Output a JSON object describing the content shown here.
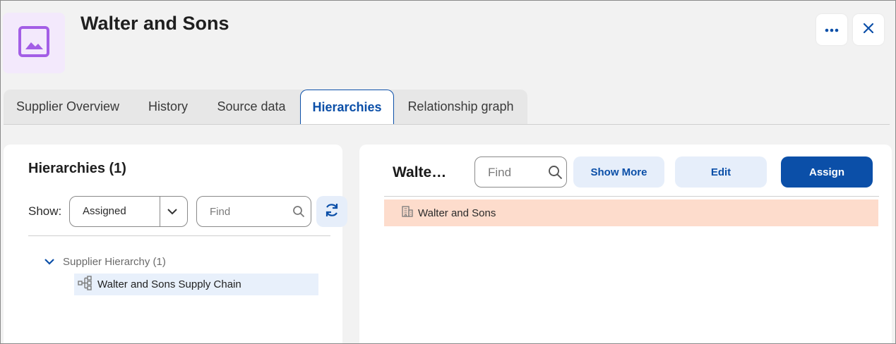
{
  "header": {
    "title": "Walter and Sons",
    "avatar_icon": "image-icon",
    "more_icon": "more-horizontal-icon",
    "close_icon": "close-icon",
    "accent": "#0b4fa8"
  },
  "tabs": [
    {
      "label": "Supplier Overview",
      "active": false
    },
    {
      "label": "History",
      "active": false
    },
    {
      "label": "Source data",
      "active": false
    },
    {
      "label": "Hierarchies",
      "active": true
    },
    {
      "label": "Relationship graph",
      "active": false
    }
  ],
  "left_panel": {
    "title": "Hierarchies (1)",
    "show_label": "Show:",
    "show_selected": "Assigned",
    "find_placeholder": "Find",
    "tree": {
      "group_label": "Supplier Hierarchy (1)",
      "items": [
        {
          "label": "Walter and Sons Supply Chain"
        }
      ]
    }
  },
  "right_panel": {
    "title": "Walte…",
    "find_placeholder": "Find",
    "show_more_label": "Show More",
    "edit_label": "Edit",
    "assign_label": "Assign",
    "result_label": "Walter and Sons",
    "result_color": "#fddccc"
  }
}
